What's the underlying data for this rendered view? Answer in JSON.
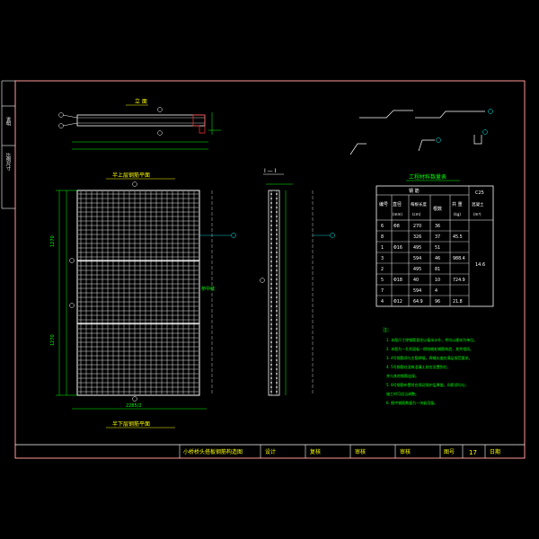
{
  "colors": {
    "background": "#000000",
    "frame": "#ff0000",
    "sheet_border": "#ffffff",
    "dims": "#00ff00",
    "detail": "#ffffff",
    "callout": "#00ffff",
    "rebar_grid": "#ffffff",
    "title_text": "#ffff00",
    "notes_text": "#00ff00",
    "table_lines": "#ffffff"
  },
  "left_strip": {
    "cell_1": "说明",
    "cell_2": "比例尺寸"
  },
  "views": {
    "elevation_title": "立 面",
    "top_plan_title": "半上层钢筋平面",
    "bottom_plan_title": "半下层钢筋平面",
    "section_title": "I — I",
    "left_dim": "1270",
    "left_dim_2": "1270",
    "total_width_label": "25",
    "bottom_dim": "2285/2",
    "side_label": "桥中线"
  },
  "bars": {
    "b1": "1",
    "b2": "2",
    "b3": "3",
    "b4": "4",
    "b5": "5",
    "b6": "6",
    "b7": "7",
    "b8": "8"
  },
  "table": {
    "title": "工程材料数量表",
    "headers": {
      "group": "钢 筋",
      "no": "编号",
      "diameter": "直径",
      "diameter_unit": "(mm)",
      "length": "每根长度",
      "length_unit": "(cm)",
      "count": "根数",
      "total": "共 重",
      "total_unit": "(kg)",
      "concrete_grade": "C25",
      "concrete": "混凝土",
      "concrete_unit": "(m³)"
    },
    "rows": [
      {
        "no": "6",
        "dia": "Φ8",
        "len": "270",
        "cnt": "36",
        "wt": ""
      },
      {
        "no": "8",
        "dia": "",
        "len": "326",
        "cnt": "37",
        "wt": "45.5"
      },
      {
        "no": "1",
        "dia": "Φ16",
        "len": "495",
        "cnt": "51",
        "wt": ""
      },
      {
        "no": "3",
        "dia": "",
        "len": "594",
        "cnt": "46",
        "wt": "988.4"
      },
      {
        "no": "2",
        "dia": "",
        "len": "495",
        "cnt": "81",
        "wt": ""
      },
      {
        "no": "5",
        "dia": "Φ18",
        "len": "40",
        "cnt": "10",
        "wt": "724.9"
      },
      {
        "no": "7",
        "dia": "",
        "len": "594",
        "cnt": "4",
        "wt": ""
      },
      {
        "no": "4",
        "dia": "Φ12",
        "len": "64.9",
        "cnt": "96",
        "wt": "21.8"
      }
    ],
    "concrete_value": "14.6"
  },
  "notes": {
    "heading": "注：",
    "items": [
      "1. 本图尺寸除钢筋直径以毫米计外，余均以厘米为单位。",
      "2. 本图为一孔桥面板一侧铰缝处钢筋构造，其余相同。",
      "3. 4号钢筋须与主筋焊接，焊缝长度应满足规范要求。",
      "4. 5号钢筋在浇筑混凝土前应设置到位，",
      "   并与其他钢筋连接。",
      "5. 8号钢筋布置时应保证保护层厚度，间距须均匀，",
      "   施工时可适当调整。",
      "6. 图中钢筋数量为一块板用量。"
    ]
  },
  "title_block": {
    "drawing_title": "小桥桥头搭板钢筋构造图",
    "design": "设计",
    "check": "复核",
    "approve_1": "审核",
    "approve_2": "审核",
    "sheet_label": "图号",
    "sheet_no": "17",
    "date_label": "日期"
  }
}
